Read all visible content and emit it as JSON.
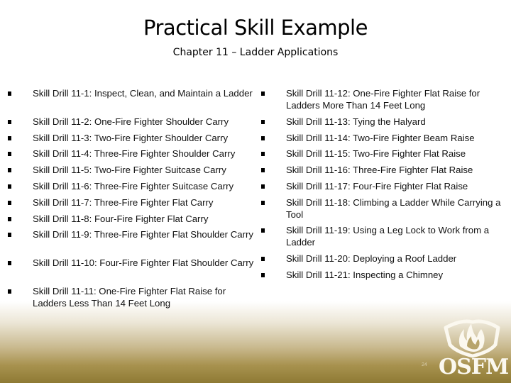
{
  "slide": {
    "title": "Practical Skill Example",
    "subtitle": "Chapter 11 – Ladder Applications",
    "page_number": "24",
    "logo_text": "OSFM",
    "colors": {
      "footer_gold": "#8e7a34",
      "background": "#ffffff"
    }
  },
  "left_items": [
    "Skill Drill 11-1: Inspect, Clean, and Maintain a Ladder",
    "Skill Drill 11-2: One-Fire Fighter Shoulder Carry",
    "Skill Drill 11-3: Two-Fire Fighter Shoulder Carry",
    "Skill Drill 11-4: Three-Fire Fighter Shoulder Carry",
    "Skill Drill 11-5: Two-Fire Fighter Suitcase Carry",
    "Skill Drill 11-6: Three-Fire Fighter Suitcase Carry",
    "Skill Drill 11-7: Three-Fire Fighter Flat Carry",
    "Skill Drill 11-8: Four-Fire Fighter Flat Carry",
    "Skill Drill 11-9: Three-Fire Fighter Flat Shoulder Carry",
    "Skill Drill 11-10: Four-Fire Fighter Flat Shoulder Carry",
    "Skill Drill 11-11: One-Fire Fighter Flat Raise for Ladders Less Than 14 Feet Long"
  ],
  "right_items": [
    "Skill Drill 11-12: One-Fire Fighter Flat Raise for Ladders More Than 14 Feet Long",
    "Skill Drill 11-13: Tying the Halyard",
    "Skill Drill 11-14: Two-Fire Fighter Beam Raise",
    "Skill Drill 11-15: Two-Fire Fighter Flat Raise",
    "Skill Drill 11-16: Three-Fire Fighter Flat Raise",
    "Skill Drill 11-17: Four-Fire Fighter Flat Raise",
    "Skill Drill 11-18: Climbing a Ladder While Carrying a Tool",
    "Skill Drill 11-19: Using a Leg Lock to Work from a Ladder",
    "Skill Drill 11-20: Deploying a Roof Ladder",
    "Skill Drill 11-21: Inspecting a Chimney"
  ]
}
